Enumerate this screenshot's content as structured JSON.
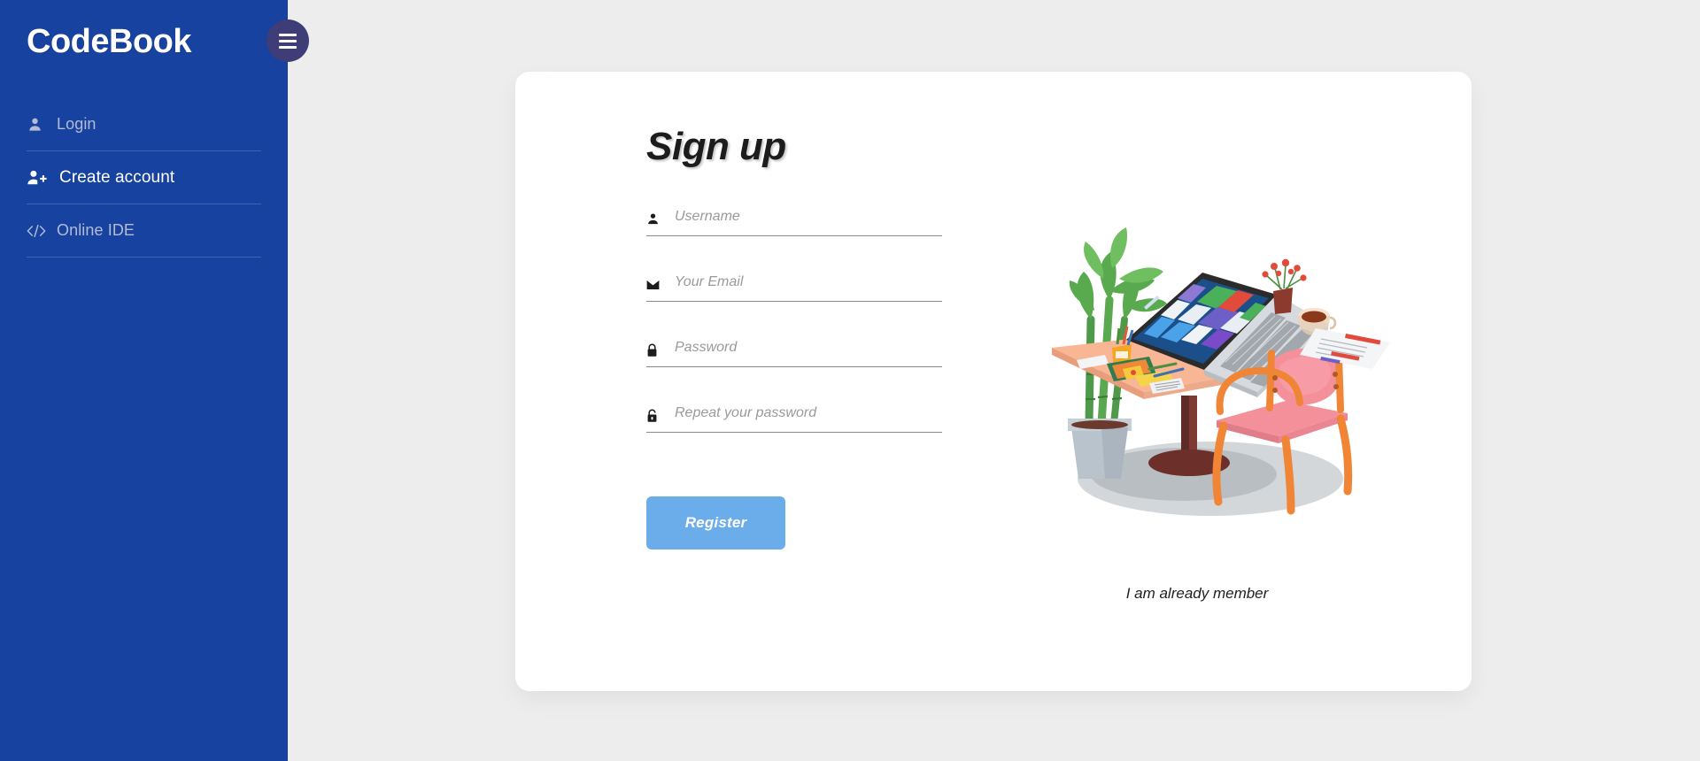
{
  "brand": {
    "name": "CodeBook"
  },
  "menu_toggle": {
    "icon": "hamburger-icon",
    "label": "Toggle menu"
  },
  "sidebar": {
    "items": [
      {
        "label": "Login",
        "icon": "user-icon",
        "active": false
      },
      {
        "label": "Create account",
        "icon": "user-plus-icon",
        "active": true
      },
      {
        "label": "Online IDE",
        "icon": "code-icon",
        "active": false
      }
    ]
  },
  "main": {
    "title": "Sign up",
    "fields": [
      {
        "name": "username",
        "placeholder": "Username",
        "value": "",
        "icon": "user-icon",
        "type": "text"
      },
      {
        "name": "email",
        "placeholder": "Your Email",
        "value": "",
        "icon": "mail-icon",
        "type": "email"
      },
      {
        "name": "password",
        "placeholder": "Password",
        "value": "",
        "icon": "lock-icon",
        "type": "password"
      },
      {
        "name": "confirm_password",
        "placeholder": "Repeat your password",
        "value": "",
        "icon": "lock-open-icon",
        "type": "password"
      }
    ],
    "submit_label": "Register",
    "already_member_label": "I am already member",
    "illustration": {
      "name": "desk-workspace-illustration",
      "description": "Peach desk with open laptop showing Windows tile start screen, bamboo plant in grey pot, pink and orange chair, papers, coffee cup and small red flowers"
    }
  },
  "colors": {
    "sidebar_blue": "#17429f",
    "page_background": "#ededed",
    "card_background": "#ffffff",
    "button_blue": "#6bacea",
    "hamburger_purple": "#3e3d77",
    "nav_inactive_text": "#b3bcd4",
    "nav_active_text": "#ffffff",
    "placeholder_gray": "#9a9a9a",
    "field_underline": "#8a8a8a"
  }
}
